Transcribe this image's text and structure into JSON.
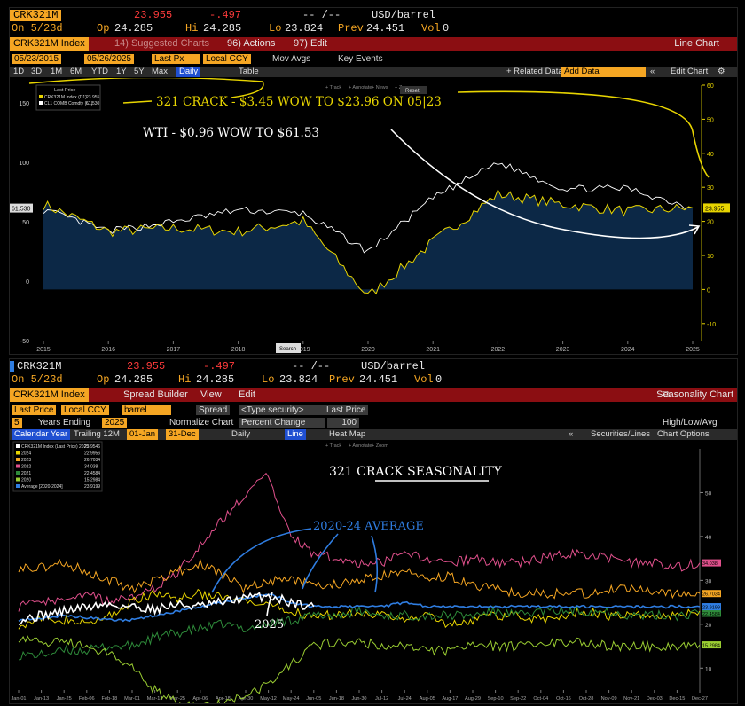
{
  "top": {
    "quote": {
      "ticker": "CRK321M",
      "last": "23.955",
      "change": "-.497",
      "time": "-- /--",
      "unit": "USD/barrel",
      "on": "On 5/23d",
      "op_label": "Op",
      "op": "24.285",
      "hi_label": "Hi",
      "hi": "24.285",
      "lo_label": "Lo",
      "lo": "23.824",
      "prev_label": "Prev",
      "prev": "24.451",
      "vol_label": "Vol",
      "vol": "0"
    },
    "menu": {
      "index": "CRK321M Index",
      "suggested": "14) Suggested Charts",
      "actions": "96) Actions",
      "edit": "97) Edit",
      "title": "Line Chart"
    },
    "options": {
      "start": "05/23/2015",
      "end": "05/26/2025",
      "field": "Last Px",
      "ccy": "Local CCY",
      "mov": "Mov Avgs",
      "key": "Key Events"
    },
    "nav": {
      "items": [
        "1D",
        "3D",
        "1M",
        "6M",
        "YTD",
        "1Y",
        "5Y",
        "Max"
      ],
      "daily": "Daily",
      "table": "Table",
      "related": "+ Related Data",
      "add": "Add Data",
      "editchart": "Edit Chart"
    },
    "legend": {
      "header": "Last Price",
      "items": [
        {
          "label": "CRK321M Index (D1)",
          "value": "23.955",
          "color": "#e8d500"
        },
        {
          "label": "CL1 COMB Comdty (L1)",
          "value": "61.530",
          "color": "#ffffff"
        }
      ]
    },
    "toolbar": [
      "Track",
      "Annotate",
      "News",
      "Zoom"
    ],
    "reset": "Reset",
    "search": "Search",
    "annotations": [
      "321 CRACK - $3.45 WOW TO $23.96 ON 05|23",
      "WTI  - $0.96 WOW TO $61.53"
    ]
  },
  "bottom": {
    "quote": {
      "ticker": "CRK321M",
      "last": "23.955",
      "change": "-.497",
      "time": "-- /--",
      "unit": "USD/barrel",
      "on": "On 5/23d",
      "op_label": "Op",
      "op": "24.285",
      "hi_label": "Hi",
      "hi": "24.285",
      "lo_label": "Lo",
      "lo": "23.824",
      "prev_label": "Prev",
      "prev": "24.451",
      "vol_label": "Vol",
      "vol": "0"
    },
    "menu": {
      "index": "CRK321M Index",
      "spread": "Spread Builder",
      "view": "View",
      "edit": "Edit",
      "title": "Seasonality Chart"
    },
    "options": {
      "field": "Last Price",
      "ccy": "Local CCY",
      "unit": "barrel",
      "spread": "Spread",
      "type": "<Type security>",
      "field2": "Last Price",
      "years": "5",
      "years_label": "Years Ending",
      "year": "2025",
      "normalize": "Normalize Chart",
      "pct": "Percent Change",
      "base": "100",
      "hla": "High/Low/Avg"
    },
    "nav": {
      "calendar": "Calendar Year",
      "trailing": "Trailing 12M",
      "from": "01-Jan",
      "to": "31-Dec",
      "daily": "Daily",
      "line": "Line",
      "heat": "Heat Map",
      "securities": "Securities/Lines",
      "chartopts": "Chart Options"
    },
    "toolbar": [
      "Track",
      "Annotate",
      "Zoom"
    ],
    "legend": [
      {
        "label": "CRK321M Index (Last Price) 2025",
        "value": "23.9546",
        "color": "#ffffff"
      },
      {
        "label": "2024",
        "value": "22.9956",
        "color": "#e8d500"
      },
      {
        "label": "2023",
        "value": "26.7034",
        "color": "#f5a623"
      },
      {
        "label": "2022",
        "value": "34.038",
        "color": "#e0508c"
      },
      {
        "label": "2021",
        "value": "22.4584",
        "color": "#2e8b3a"
      },
      {
        "label": "2020",
        "value": "15.2984",
        "color": "#9acd32"
      },
      {
        "label": "Average [2020-2024]",
        "value": "23.9199",
        "color": "#2f7de1"
      }
    ],
    "annotations": {
      "title": "321 CRACK SEASONALITY",
      "avg": "2020-24 AVERAGE",
      "y2025": "2025"
    }
  },
  "chart_data": [
    {
      "type": "line",
      "title": "",
      "x": [
        "2015",
        "2016",
        "2017",
        "2018",
        "2019",
        "2020",
        "2021",
        "2022",
        "2023",
        "2024",
        "2025"
      ],
      "series": [
        {
          "name": "CRK321M Index (D1)",
          "axis": "right",
          "values": [
            25,
            17,
            18,
            17,
            20,
            -2,
            14,
            28,
            25,
            23,
            23.955
          ]
        },
        {
          "name": "CL1 COMB Comdty (L1)",
          "axis": "left",
          "values": [
            60,
            42,
            50,
            60,
            57,
            25,
            70,
            100,
            78,
            78,
            61.53
          ]
        }
      ],
      "left_ylim": [
        -50,
        165
      ],
      "left_ticks": [
        -50,
        0,
        50,
        100,
        150
      ],
      "right_ylim": [
        -15,
        60
      ],
      "right_ticks": [
        -10,
        0,
        10,
        20,
        30,
        40,
        50,
        60
      ]
    },
    {
      "type": "line",
      "title": "",
      "x": [
        "Jan-01",
        "Jan-13",
        "Jan-25",
        "Feb-06",
        "Feb-18",
        "Mar-01",
        "Mar-13",
        "Mar-25",
        "Apr-06",
        "Apr-18",
        "Apr-30",
        "May-12",
        "May-24",
        "Jun-05",
        "Jun-18",
        "Jun-30",
        "Jul-12",
        "Jul-24",
        "Aug-05",
        "Aug-17",
        "Aug-29",
        "Sep-10",
        "Sep-22",
        "Oct-04",
        "Oct-16",
        "Oct-28",
        "Nov-09",
        "Nov-21",
        "Dec-03",
        "Dec-15",
        "Dec-27"
      ],
      "ylim": [
        5,
        60
      ],
      "y_ticks": [
        10,
        20,
        30,
        40,
        50
      ],
      "series": [
        {
          "name": "2025",
          "values": [
            21,
            22,
            23,
            24,
            24.5,
            24,
            23.5,
            24.5,
            24,
            25,
            26,
            26.5,
            25,
            24
          ]
        },
        {
          "name": "2024",
          "values": [
            20,
            21,
            21,
            20,
            22,
            25,
            27,
            26,
            27,
            26,
            25,
            24,
            23,
            22,
            22,
            23,
            22,
            21,
            22,
            20,
            21,
            22,
            22,
            21,
            22,
            23,
            22,
            22,
            22,
            22,
            23
          ]
        },
        {
          "name": "2023",
          "values": [
            33,
            33,
            34,
            32,
            30,
            28,
            30,
            32,
            34,
            31,
            28,
            30,
            30,
            29,
            29,
            30,
            31,
            32,
            30,
            31,
            29,
            28,
            27,
            27,
            27,
            27,
            28,
            28,
            27,
            27,
            27
          ]
        },
        {
          "name": "2022",
          "values": [
            24,
            25,
            26,
            27,
            25,
            26,
            28,
            32,
            38,
            44,
            50,
            54,
            40,
            36,
            35,
            34,
            34,
            36,
            35,
            34,
            35,
            34,
            34,
            35,
            36,
            36,
            35,
            34,
            34,
            33,
            34
          ]
        },
        {
          "name": "2021",
          "values": [
            13,
            13,
            14,
            14,
            15,
            15,
            17,
            18,
            19,
            20,
            19,
            20,
            21,
            22,
            22,
            23,
            22,
            22,
            22,
            22,
            22,
            23,
            22,
            23,
            23,
            23,
            23,
            22,
            22,
            22,
            22.5
          ]
        },
        {
          "name": "2020",
          "values": [
            17,
            16,
            16,
            15,
            13,
            10,
            5,
            2,
            1,
            2,
            4,
            6,
            11,
            15,
            16,
            16,
            15,
            15,
            14,
            14,
            15,
            15,
            15,
            16,
            16,
            16,
            15,
            15,
            15,
            15,
            15.3
          ]
        },
        {
          "name": "Average [2020-2024]",
          "values": [
            21,
            21.5,
            22,
            21.5,
            21,
            21,
            22,
            23,
            24,
            25,
            26,
            27,
            25,
            24,
            24,
            24,
            24,
            25,
            24,
            24,
            24,
            24,
            24,
            24,
            24,
            24,
            24,
            24,
            24,
            24,
            24
          ]
        }
      ]
    }
  ]
}
